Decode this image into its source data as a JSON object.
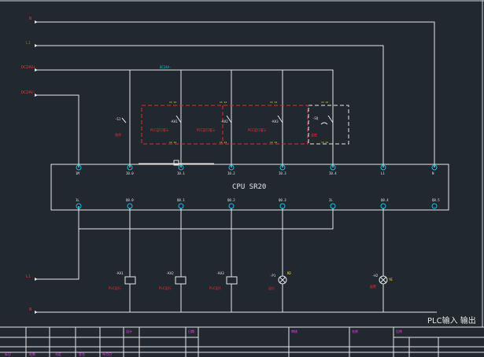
{
  "drawing": {
    "title": "PLC输入 输出",
    "cpu_model": "CPU SR20",
    "colors": {
      "background": "#212830",
      "wire": "#e6e6e6",
      "terminal": "#00c8e6",
      "label_red": "#ff2828",
      "label_yellow": "#ffe600",
      "label_magenta": "#ff3cff",
      "dashed_box": "#e62828"
    },
    "power_lines": [
      {
        "label": "N"
      },
      {
        "label": "L1"
      },
      {
        "label": "DC24V+"
      },
      {
        "label": "DC24V-"
      }
    ],
    "bottom_lines": [
      {
        "label": "L1"
      },
      {
        "label": "N"
      }
    ],
    "top_bus": {
      "label": "DC24V-"
    },
    "switches": [
      {
        "label": "-S1",
        "note": "急停"
      },
      {
        "label": "-KA1",
        "note": "PLC运行指示"
      },
      {
        "label": "-KA2",
        "note": "PLC运行指示"
      },
      {
        "label": "-KA3",
        "note": "PLC运行指示"
      },
      {
        "label": "-SQ",
        "note": "温度"
      }
    ],
    "input_terminals": [
      {
        "label": "1M"
      },
      {
        "label": "I0.0"
      },
      {
        "label": "I0.1"
      },
      {
        "label": "I0.2"
      },
      {
        "label": "I0.3"
      },
      {
        "label": "I0.4"
      },
      {
        "label": "L1"
      },
      {
        "label": "N"
      }
    ],
    "output_terminals": [
      {
        "label": "1L"
      },
      {
        "label": "Q0.0"
      },
      {
        "label": "Q0.1"
      },
      {
        "label": "Q0.2"
      },
      {
        "label": "Q0.3"
      },
      {
        "label": "2L"
      },
      {
        "label": "Q0.4"
      },
      {
        "label": "Q0.5"
      }
    ],
    "loads": [
      {
        "label": "-KA1",
        "note": "PLC运行",
        "kind": "relay"
      },
      {
        "label": "-KA2",
        "note": "PLC运行",
        "kind": "relay"
      },
      {
        "label": "-KA3",
        "note": "PLC运行",
        "kind": "relay"
      },
      {
        "label": "-P1",
        "note": "运行",
        "kind": "lamp",
        "tag": "RD"
      },
      {
        "label": "-H2",
        "note": "报警",
        "kind": "lamp",
        "tag": "YE"
      }
    ],
    "title_block": {
      "row1": [
        "设计",
        "日期",
        "审核",
        "名称",
        "比例"
      ],
      "row2": [
        "标记",
        "处数",
        "分区",
        "签名",
        "年月日"
      ]
    }
  }
}
